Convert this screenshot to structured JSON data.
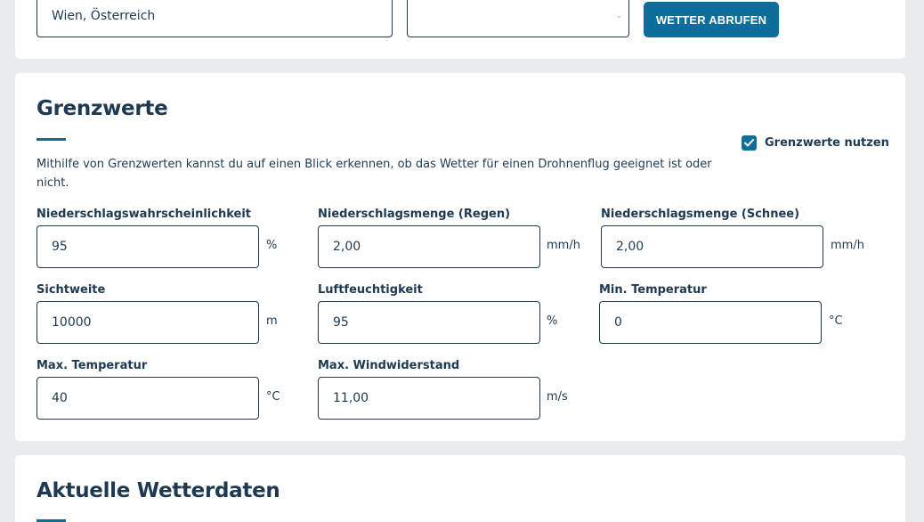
{
  "location": {
    "city_value": "Wien, Österreich",
    "select_value": "",
    "fetch_button_label": "WETTER ABRUFEN"
  },
  "limits": {
    "title": "Grenzwerte",
    "use_checkbox_label": "Grenzwerte nutzen",
    "use_checkbox_checked": true,
    "description": "Mithilfe von Grenzwerten kannst du auf einen Blick erkennen, ob das Wetter für einen Drohnenflug geeignet ist oder nicht.",
    "fields": [
      {
        "label": "Niederschlagswahrscheinlichkeit",
        "value": "95",
        "unit": "%"
      },
      {
        "label": "Niederschlagsmenge (Regen)",
        "value": "2,00",
        "unit": "mm/h"
      },
      {
        "label": "Niederschlagsmenge (Schnee)",
        "value": "2,00",
        "unit": "mm/h"
      },
      {
        "label": "Sichtweite",
        "value": "10000",
        "unit": "m"
      },
      {
        "label": "Luftfeuchtigkeit",
        "value": "95",
        "unit": "%"
      },
      {
        "label": "Min. Temperatur",
        "value": "0",
        "unit": "°C"
      },
      {
        "label": "Max. Temperatur",
        "value": "40",
        "unit": "°C"
      },
      {
        "label": "Max. Windwiderstand",
        "value": "11,00",
        "unit": "m/s"
      }
    ]
  },
  "weather": {
    "title": "Aktuelle Wetterdaten"
  },
  "colors": {
    "accent": "#0d6e9c",
    "text": "#1e3a52",
    "background": "#e9edf0"
  }
}
